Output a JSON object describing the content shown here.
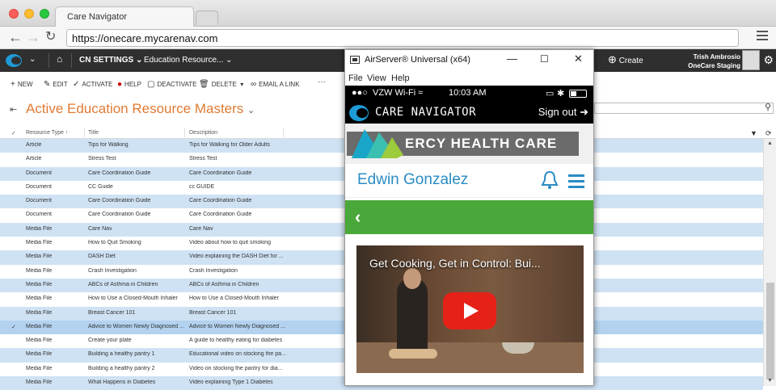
{
  "browser": {
    "tab_title": "Care Navigator",
    "url": "https://onecare.mycarenav.com"
  },
  "app": {
    "nav": {
      "area": "CN SETTINGS",
      "entity": "Education Resource...",
      "create": "Create",
      "user_name": "Trish Ambrosio",
      "org": "OneCare Staging"
    },
    "commands": [
      "NEW",
      "EDIT",
      "ACTIVATE",
      "HELP",
      "DEACTIVATE",
      "DELETE",
      "EMAIL A LINK"
    ],
    "view_title": "Active Education Resource Masters",
    "columns": [
      "Resource Type",
      "Title",
      "Description"
    ],
    "rows": [
      {
        "type": "Article",
        "title": "Tips for Walking",
        "desc": "Tips for Walking for Older Adults",
        "style": "alt",
        "check": ""
      },
      {
        "type": "Article",
        "title": "Stress Test",
        "desc": "Stress Test",
        "style": "",
        "check": ""
      },
      {
        "type": "Document",
        "title": "Care Coordination Guide",
        "desc": "Care Coordination Guide",
        "style": "alt",
        "check": ""
      },
      {
        "type": "Document",
        "title": "CC Guide",
        "desc": "cc GUIDE",
        "style": "",
        "check": ""
      },
      {
        "type": "Document",
        "title": "Care Coordination Guide",
        "desc": "Care Coordination Guide",
        "style": "alt",
        "check": ""
      },
      {
        "type": "Document",
        "title": "Care Coordination Guide",
        "desc": "Care Coordination Guide",
        "style": "",
        "check": ""
      },
      {
        "type": "Media File",
        "title": "Care Nav",
        "desc": "Care Nav",
        "style": "alt",
        "check": ""
      },
      {
        "type": "Media File",
        "title": "How to Quit Smoking",
        "desc": "Video about how to quit smoking",
        "style": "",
        "check": ""
      },
      {
        "type": "Media File",
        "title": "DASH Diet",
        "desc": "Video explaining the DASH Diet for ...",
        "style": "alt",
        "check": ""
      },
      {
        "type": "Media File",
        "title": "Crash Investigation",
        "desc": "Crash Investigation",
        "style": "",
        "check": ""
      },
      {
        "type": "Media File",
        "title": "ABCs of Asthma in Children",
        "desc": "ABCs of Asthma in Children",
        "style": "alt",
        "check": ""
      },
      {
        "type": "Media File",
        "title": "How to Use a Closed-Mouth Inhaler",
        "desc": "How to Use a Closed-Mouth Inhaler",
        "style": "",
        "check": ""
      },
      {
        "type": "Media File",
        "title": "Breast Cancer 101",
        "desc": "Breast Cancer 101",
        "style": "alt",
        "check": ""
      },
      {
        "type": "Media File",
        "title": "Advice to Women Newly Diagnosed ...",
        "desc": "Advice to Women Newly Diagnosed ...",
        "style": "sel",
        "check": "✓"
      },
      {
        "type": "Media File",
        "title": "Create your plate",
        "desc": "A guide to healthy eating for diabetes",
        "style": "",
        "check": ""
      },
      {
        "type": "Media File",
        "title": "Building a healthy pantry 1",
        "desc": "Educational video on stocking the pa...",
        "style": "alt",
        "check": ""
      },
      {
        "type": "Media File",
        "title": "Building a healthy pantry 2",
        "desc": "Video on stocking the pantry for dia...",
        "style": "",
        "check": ""
      },
      {
        "type": "Media File",
        "title": "What Happens in Diabetes",
        "desc": "Video explaining Type 1 Diabetes",
        "style": "alt",
        "check": ""
      }
    ]
  },
  "airserver": {
    "title": "AirServer® Universal (x64)",
    "menu": [
      "File",
      "View",
      "Help"
    ]
  },
  "phone": {
    "carrier": "VZW Wi-Fi",
    "time": "10:03 AM",
    "brand": "CARE NAVIGATOR",
    "signout": "Sign out",
    "mercy": "ERCY HEALTH CARE",
    "user_name": "Edwin Gonzalez",
    "video_title": "Get Cooking, Get in Control: Bui..."
  },
  "colors": {
    "accent_orange": "#e07a32",
    "row_alt": "#cfe2f4",
    "row_selected": "#b3d2ef",
    "phone_blue": "#2a8cc4",
    "phone_green": "#4aa83a",
    "youtube_red": "#e62117"
  },
  "icons": [
    "back-icon",
    "forward-icon",
    "reload-icon",
    "menu-icon",
    "home-icon",
    "plus-icon",
    "check-icon",
    "help-icon",
    "trash-icon",
    "link-icon",
    "pin-icon",
    "search-icon",
    "filter-icon",
    "gear-icon",
    "bell-icon",
    "hamburger-icon",
    "chevron-left-icon",
    "play-icon",
    "wifi-icon",
    "battery-icon",
    "signout-icon"
  ]
}
